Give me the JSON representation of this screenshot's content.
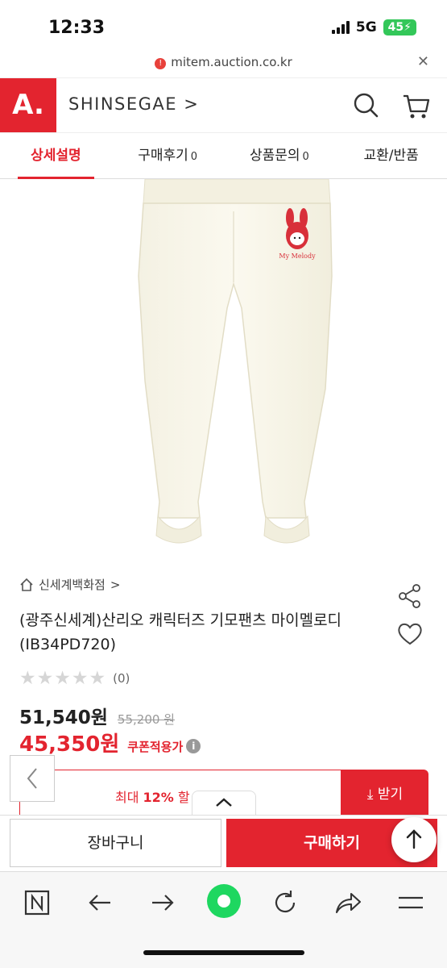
{
  "status": {
    "time": "12:33",
    "network": "5G",
    "battery": "45"
  },
  "browser": {
    "url": "mitem.auction.co.kr"
  },
  "header": {
    "logo_text": "A.",
    "brand": "SHINSEGAE",
    "brand_chevron": ">"
  },
  "tabs": [
    {
      "label": "상세설명",
      "count": ""
    },
    {
      "label": "구매후기",
      "count": "0"
    },
    {
      "label": "상품문의",
      "count": "0"
    },
    {
      "label": "교환/반품",
      "count": ""
    }
  ],
  "product": {
    "image_badge_text": "My Melody",
    "store_name": "신세계백화점",
    "store_chevron": ">",
    "title": "(광주신세계)산리오 캐릭터즈 기모팬츠 마이멜로디(IB34PD720)",
    "stars": [
      "★",
      "★",
      "★",
      "★",
      "★"
    ],
    "rating_count": "(0)",
    "price": "51,540원",
    "original_price": "55,200 원",
    "coupon_price": "45,350원",
    "coupon_label": "쿠폰적용가",
    "info_icon": "i"
  },
  "coupon_banner": {
    "prefix": "최대 ",
    "percent": "12%",
    "suffix": " 할",
    "button_label": "받기"
  },
  "actions": {
    "cart_label": "장바구니",
    "buy_label": "구매하기"
  },
  "colors": {
    "brand_red": "#e3242f",
    "battery_green": "#33c759",
    "toolbar_green": "#1ed760"
  }
}
